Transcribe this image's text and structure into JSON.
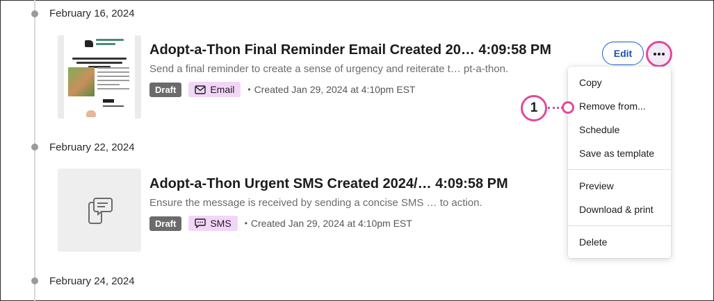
{
  "timeline": {
    "dates": [
      "February 16, 2024",
      "February 22, 2024",
      "February 24, 2024"
    ]
  },
  "campaigns": [
    {
      "title": "Adopt-a-Thon Final Reminder Email Created 20… 4:09:58 PM",
      "description": "Send a final reminder to create a sense of urgency and reiterate t…  pt-a-thon.",
      "status": "Draft",
      "channel": "Email",
      "channel_icon": "envelope-icon",
      "created": "Created Jan 29, 2024 at 4:10pm EST"
    },
    {
      "title": "Adopt-a-Thon Urgent SMS Created 2024/…  4:09:58 PM",
      "description": "Ensure the message is received by sending a concise SMS …  to action.",
      "status": "Draft",
      "channel": "SMS",
      "channel_icon": "chat-bubble-icon",
      "created": "Created Jan 29, 2024 at 4:10pm EST"
    }
  ],
  "actions": {
    "edit_label": "Edit",
    "more_icon": "ellipsis-icon"
  },
  "menu": {
    "items": [
      "Copy",
      "Remove from...",
      "Schedule",
      "Save as template",
      "Preview",
      "Download & print",
      "Delete"
    ]
  },
  "callout": {
    "number": "1"
  },
  "colors": {
    "accent": "#e2489a",
    "edit_blue": "#1a5bc8",
    "draft_badge": "#6b6b6b",
    "channel_badge": "#f2d6f7"
  }
}
